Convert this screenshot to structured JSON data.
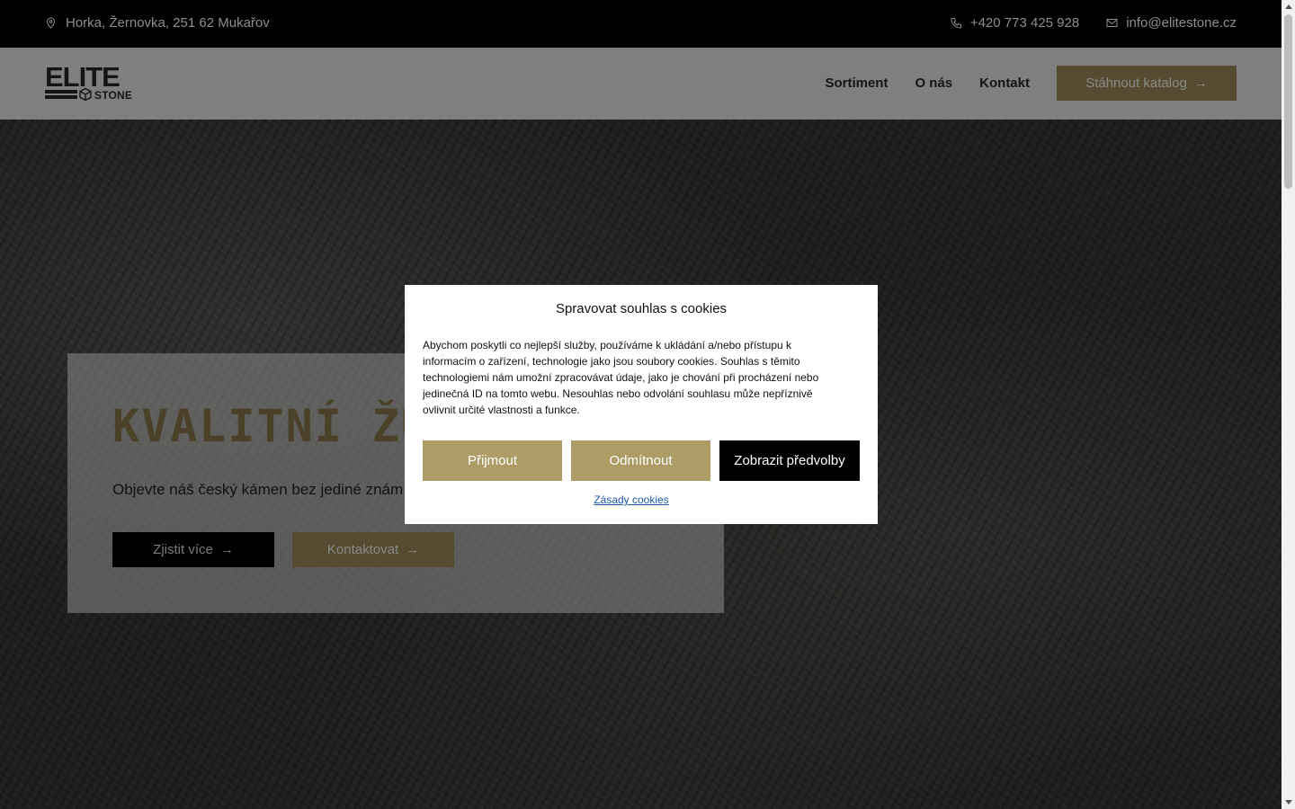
{
  "topbar": {
    "address": "Horka, Žernovka, 251 62 Mukařov",
    "phone": "+420 773 425 928",
    "email": "info@elitestone.cz"
  },
  "header": {
    "logo_main": "ELITE",
    "logo_sub": "STONE",
    "nav": [
      "Sortiment",
      "O nás",
      "Kontakt"
    ],
    "catalog_button": "Stáhnout katalog"
  },
  "hero": {
    "title": "KVALITNÍ ŽU",
    "subtitle": "Objevte náš český kámen bez jediné znám",
    "learn_more": "Zjistit více",
    "contact": "Kontaktovat"
  },
  "cookie_modal": {
    "title": "Spravovat souhlas s cookies",
    "text": "Abychom poskytli co nejlepší služby, používáme k ukládání a/nebo přístupu k informacím o zařízení, technologie jako jsou soubory cookies. Souhlas s těmito technologiemi nám umožní zpracovávat údaje, jako je chování při procházení nebo jedinečná ID na tomto webu. Nesouhlas nebo odvolání souhlasu může nepříznivě ovlivnit určité vlastnosti a funkce.",
    "accept": "Přijmout",
    "deny": "Odmítnout",
    "preferences": "Zobrazit předvolby",
    "policy_link": "Zásady cookies"
  },
  "colors": {
    "gold": "#ad9c66",
    "gold_dim": "#564b31",
    "black": "#000000"
  },
  "icons": {
    "address": "location-pin-icon",
    "phone": "phone-icon",
    "email": "envelope-icon",
    "arrow": "arrow-right-icon"
  }
}
